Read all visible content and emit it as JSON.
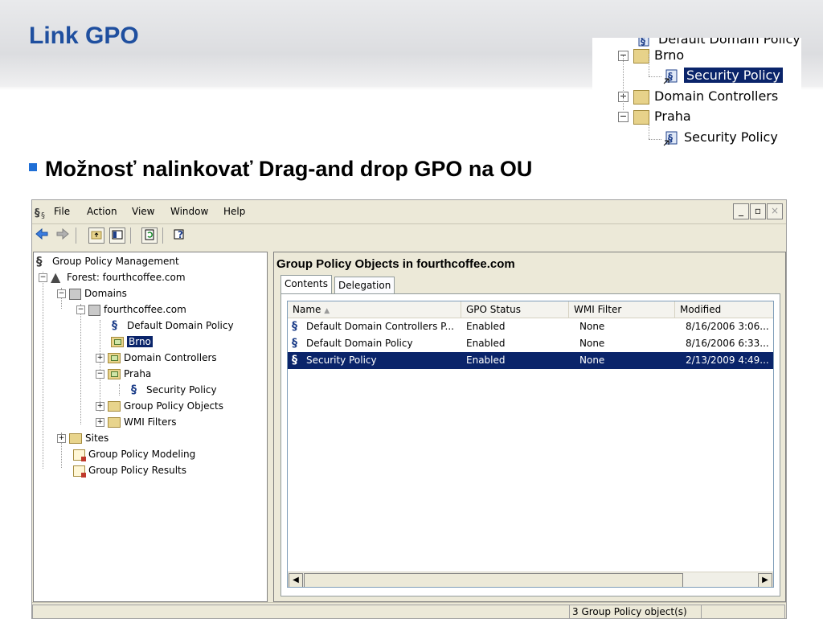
{
  "slide": {
    "title": "Link GPO",
    "bullet": "Možnosť nalinkovať Drag-and drop GPO na OU"
  },
  "inset": {
    "items": [
      {
        "label": "Default Domain Policy",
        "icon": "gpo-icon"
      },
      {
        "label": "Brno",
        "icon": "ou-icon",
        "expander": "−"
      },
      {
        "label": "Security Policy",
        "icon": "gpo-link-icon",
        "selected": true
      },
      {
        "label": "Domain Controllers",
        "icon": "ou-icon",
        "expander": "+"
      },
      {
        "label": "Praha",
        "icon": "ou-icon",
        "expander": "−"
      },
      {
        "label": "Security Policy",
        "icon": "gpo-link-icon"
      }
    ]
  },
  "window": {
    "menu": [
      "File",
      "Action",
      "View",
      "Window",
      "Help"
    ],
    "window_buttons": [
      "_",
      "▫",
      "×"
    ],
    "tree": [
      {
        "label": "Group Policy Management",
        "icon": "gpm-icon"
      },
      {
        "label": "Forest: fourthcoffee.com",
        "icon": "forest-icon",
        "expander": "−"
      },
      {
        "label": "Domains",
        "icon": "domains-icon",
        "expander": "−"
      },
      {
        "label": "fourthcoffee.com",
        "icon": "domain-icon",
        "expander": "−"
      },
      {
        "label": "Default Domain Policy",
        "icon": "gpo-link-icon"
      },
      {
        "label": "Brno",
        "icon": "ou-icon",
        "selected": true
      },
      {
        "label": "Domain Controllers",
        "icon": "ou-icon",
        "expander": "+"
      },
      {
        "label": "Praha",
        "icon": "ou-icon",
        "expander": "−"
      },
      {
        "label": "Security Policy",
        "icon": "gpo-link-icon"
      },
      {
        "label": "Group Policy Objects",
        "icon": "gpo-container-icon",
        "expander": "+"
      },
      {
        "label": "WMI Filters",
        "icon": "wmi-folder-icon",
        "expander": "+"
      },
      {
        "label": "Sites",
        "icon": "sites-icon",
        "expander": "+"
      },
      {
        "label": "Group Policy Modeling",
        "icon": "modeling-icon"
      },
      {
        "label": "Group Policy Results",
        "icon": "results-icon"
      }
    ],
    "details": {
      "title": "Group Policy Objects in fourthcoffee.com",
      "tabs": [
        "Contents",
        "Delegation"
      ],
      "columns": [
        "Name",
        "GPO Status",
        "WMI Filter",
        "Modified"
      ],
      "rows": [
        [
          "Default Domain Controllers P...",
          "Enabled",
          "None",
          "8/16/2006 3:06..."
        ],
        [
          "Default Domain Policy",
          "Enabled",
          "None",
          "8/16/2006 6:33..."
        ],
        [
          "Security Policy",
          "Enabled",
          "None",
          "2/13/2009 4:49..."
        ]
      ],
      "selected_row": 2
    },
    "status": "3 Group Policy object(s)"
  },
  "colors": {
    "title": "#1f4f9f",
    "selection": "#0a246a",
    "chrome": "#ece9d8"
  }
}
